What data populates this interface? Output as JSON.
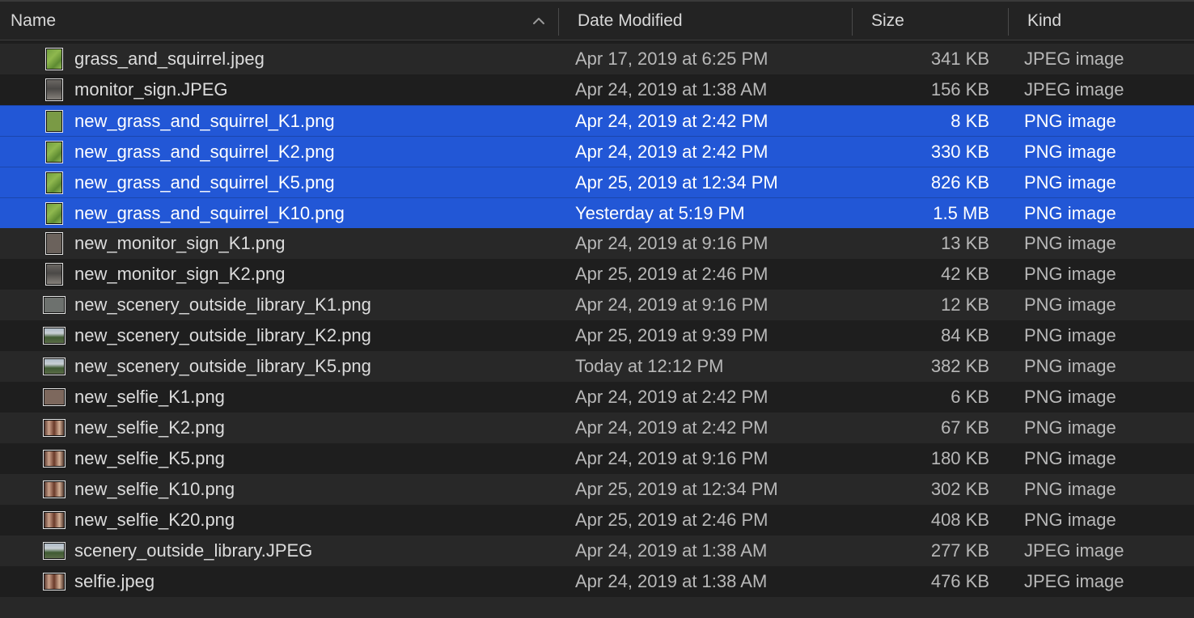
{
  "columns": {
    "name": "Name",
    "date": "Date Modified",
    "size": "Size",
    "kind": "Kind"
  },
  "colors": {
    "selection": "#2257d6",
    "row_alt": "#282828",
    "background": "#1e1e1e"
  },
  "files": [
    {
      "name": "grass_and_squirrel.jpeg",
      "date": "Apr 17, 2019 at 6:25 PM",
      "size": "341 KB",
      "kind": "JPEG image",
      "selected": false,
      "icon": "grass-thumbnail-icon",
      "thumb": "grass",
      "shape": "portrait"
    },
    {
      "name": "monitor_sign.JPEG",
      "date": "Apr 24, 2019 at 1:38 AM",
      "size": "156 KB",
      "kind": "JPEG image",
      "selected": false,
      "icon": "monitor-sign-thumbnail-icon",
      "thumb": "monitor",
      "shape": "portrait"
    },
    {
      "name": "new_grass_and_squirrel_K1.png",
      "date": "Apr 24, 2019 at 2:42 PM",
      "size": "8 KB",
      "kind": "PNG image",
      "selected": true,
      "icon": "grass-thumbnail-icon",
      "thumb": "grass-flat",
      "shape": "portrait"
    },
    {
      "name": "new_grass_and_squirrel_K2.png",
      "date": "Apr 24, 2019 at 2:42 PM",
      "size": "330 KB",
      "kind": "PNG image",
      "selected": true,
      "icon": "grass-thumbnail-icon",
      "thumb": "grass",
      "shape": "portrait"
    },
    {
      "name": "new_grass_and_squirrel_K5.png",
      "date": "Apr 25, 2019 at 12:34 PM",
      "size": "826 KB",
      "kind": "PNG image",
      "selected": true,
      "icon": "grass-thumbnail-icon",
      "thumb": "grass",
      "shape": "portrait"
    },
    {
      "name": "new_grass_and_squirrel_K10.png",
      "date": "Yesterday at 5:19 PM",
      "size": "1.5 MB",
      "kind": "PNG image",
      "selected": true,
      "icon": "grass-thumbnail-icon",
      "thumb": "grass",
      "shape": "portrait"
    },
    {
      "name": "new_monitor_sign_K1.png",
      "date": "Apr 24, 2019 at 9:16 PM",
      "size": "13 KB",
      "kind": "PNG image",
      "selected": false,
      "icon": "monitor-sign-thumbnail-icon",
      "thumb": "monitor-flat",
      "shape": "portrait"
    },
    {
      "name": "new_monitor_sign_K2.png",
      "date": "Apr 25, 2019 at 2:46 PM",
      "size": "42 KB",
      "kind": "PNG image",
      "selected": false,
      "icon": "monitor-sign-thumbnail-icon",
      "thumb": "monitor",
      "shape": "portrait"
    },
    {
      "name": "new_scenery_outside_library_K1.png",
      "date": "Apr 24, 2019 at 9:16 PM",
      "size": "12 KB",
      "kind": "PNG image",
      "selected": false,
      "icon": "scenery-thumbnail-icon",
      "thumb": "scenery-flat",
      "shape": "landscape"
    },
    {
      "name": "new_scenery_outside_library_K2.png",
      "date": "Apr 25, 2019 at 9:39 PM",
      "size": "84 KB",
      "kind": "PNG image",
      "selected": false,
      "icon": "scenery-thumbnail-icon",
      "thumb": "scenery",
      "shape": "landscape"
    },
    {
      "name": "new_scenery_outside_library_K5.png",
      "date": "Today at 12:12 PM",
      "size": "382 KB",
      "kind": "PNG image",
      "selected": false,
      "icon": "scenery-thumbnail-icon",
      "thumb": "scenery",
      "shape": "landscape"
    },
    {
      "name": "new_selfie_K1.png",
      "date": "Apr 24, 2019 at 2:42 PM",
      "size": "6 KB",
      "kind": "PNG image",
      "selected": false,
      "icon": "selfie-thumbnail-icon",
      "thumb": "selfie-flat",
      "shape": "landscape"
    },
    {
      "name": "new_selfie_K2.png",
      "date": "Apr 24, 2019 at 2:42 PM",
      "size": "67 KB",
      "kind": "PNG image",
      "selected": false,
      "icon": "selfie-thumbnail-icon",
      "thumb": "selfie",
      "shape": "landscape"
    },
    {
      "name": "new_selfie_K5.png",
      "date": "Apr 24, 2019 at 9:16 PM",
      "size": "180 KB",
      "kind": "PNG image",
      "selected": false,
      "icon": "selfie-thumbnail-icon",
      "thumb": "selfie",
      "shape": "landscape"
    },
    {
      "name": "new_selfie_K10.png",
      "date": "Apr 25, 2019 at 12:34 PM",
      "size": "302 KB",
      "kind": "PNG image",
      "selected": false,
      "icon": "selfie-thumbnail-icon",
      "thumb": "selfie",
      "shape": "landscape"
    },
    {
      "name": "new_selfie_K20.png",
      "date": "Apr 25, 2019 at 2:46 PM",
      "size": "408 KB",
      "kind": "PNG image",
      "selected": false,
      "icon": "selfie-thumbnail-icon",
      "thumb": "selfie",
      "shape": "landscape"
    },
    {
      "name": "scenery_outside_library.JPEG",
      "date": "Apr 24, 2019 at 1:38 AM",
      "size": "277 KB",
      "kind": "JPEG image",
      "selected": false,
      "icon": "scenery-thumbnail-icon",
      "thumb": "scenery",
      "shape": "landscape"
    },
    {
      "name": "selfie.jpeg",
      "date": "Apr 24, 2019 at 1:38 AM",
      "size": "476 KB",
      "kind": "JPEG image",
      "selected": false,
      "icon": "selfie-thumbnail-icon",
      "thumb": "selfie",
      "shape": "landscape"
    }
  ]
}
